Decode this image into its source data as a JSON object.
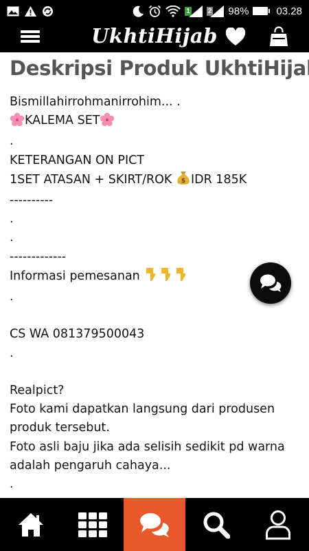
{
  "status_bar": {
    "battery": "98%",
    "time": "03.28",
    "sim1": "1",
    "sim2": "2",
    "left_icons": [
      "gallery-icon",
      "warning-icon",
      "sync-icon"
    ],
    "right_icons": [
      "moon-icon",
      "alarm-icon",
      "wifi-icon",
      "signal-icon",
      "signal-icon",
      "battery-icon"
    ]
  },
  "app_bar": {
    "brand": "UkhtiHijab",
    "icons": [
      "menu-icon",
      "heart-icon",
      "shopping-bag-icon"
    ]
  },
  "page": {
    "title": "Deskripsi Produk UkhtiHijab",
    "lines": {
      "l1": "Bismillahirrohmanirrohim... .",
      "l2": "KALEMA SET",
      "l3": ".",
      "l4": "KETERANGAN ON PICT",
      "l5a": "1SET ATASAN + SKIRT/ROK ",
      "l5b": "IDR 185K",
      "l6": "----------",
      "l7": ".",
      "l8": ".",
      "l9": "-------------",
      "l10": "Informasi pemesanan ",
      "l11": ".",
      "l12": "",
      "l13": "CS WA 081379500043",
      "l14": ".",
      "l15": "",
      "l16": "Realpict?",
      "l17": "Foto kami dapatkan langsung dari produsen",
      "l18": "produk tersebut.",
      "l19": "Foto asli baju jika ada selisih sedikit pd warna",
      "l20": "adalah pengaruh cahaya...",
      "l21": "."
    }
  },
  "floating_button": {
    "icon": "chat-bubbles-icon"
  },
  "bottom_nav": {
    "items": [
      {
        "icon": "home-icon",
        "active": false
      },
      {
        "icon": "grid-icon",
        "active": false
      },
      {
        "icon": "chat-icon",
        "active": true
      },
      {
        "icon": "search-icon",
        "active": false
      },
      {
        "icon": "user-icon",
        "active": false
      }
    ]
  },
  "colors": {
    "bar_background": "#000000",
    "active_tab": "#e8582a",
    "title_gray": "#555555"
  }
}
